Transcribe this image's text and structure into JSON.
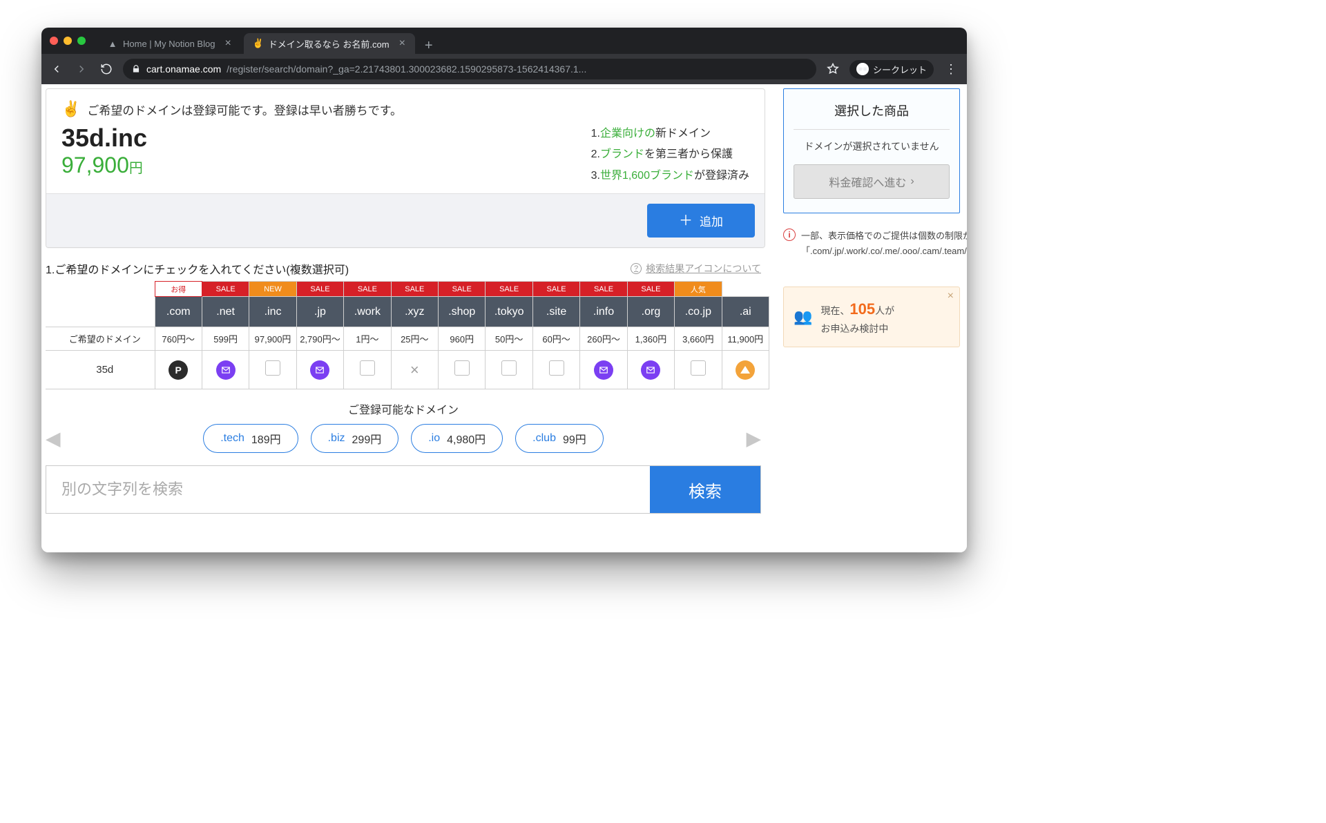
{
  "browser": {
    "tab1": "Home | My Notion Blog",
    "tab2": "ドメイン取るなら お名前.com",
    "host": "cart.onamae.com",
    "path": "/register/search/domain?_ga=2.21743801.300023682.1590295873-1562414367.1...",
    "incognito": "シークレット"
  },
  "card": {
    "msg": "ご希望のドメインは登録可能です。登録は早い者勝ちです。",
    "domain": "35d.inc",
    "price": "97,900",
    "currency": "円",
    "f1a": "1.",
    "f1b": "企業向けの",
    "f1c": "新ドメイン",
    "f2a": "2.",
    "f2b": "ブランド",
    "f2c": "を第三者から保護",
    "f3a": "3.",
    "f3b": "世界1,600ブランド",
    "f3c": "が登録済み",
    "add": "追加"
  },
  "section": {
    "title": "1.ご希望のドメインにチェックを入れてください(複数選択可)",
    "help": "検索結果アイコンについて"
  },
  "table": {
    "rowLabelHeader": "ご希望のドメイン",
    "rowDomain": "35d",
    "badges": [
      "お得",
      "SALE",
      "NEW",
      "SALE",
      "SALE",
      "SALE",
      "SALE",
      "SALE",
      "SALE",
      "SALE",
      "SALE",
      "人気"
    ],
    "tlds": [
      ".com",
      ".net",
      ".inc",
      ".jp",
      ".work",
      ".xyz",
      ".shop",
      ".tokyo",
      ".site",
      ".info",
      ".org",
      ".co.jp",
      ".ai"
    ],
    "prices": [
      "760円〜",
      "599円",
      "97,900円",
      "2,790円〜",
      "1円〜",
      "25円〜",
      "960円",
      "50円〜",
      "60円〜",
      "260円〜",
      "1,360円",
      "3,660円",
      "11,900円"
    ]
  },
  "sug": {
    "title": "ご登録可能なドメイン",
    "items": [
      {
        "tld": ".tech",
        "price": "189円"
      },
      {
        "tld": ".biz",
        "price": "299円"
      },
      {
        "tld": ".io",
        "price": "4,980円"
      },
      {
        "tld": ".club",
        "price": "99円"
      }
    ]
  },
  "search": {
    "placeholder": "別の文字列を検索",
    "button": "検索"
  },
  "sidebar": {
    "title": "選択した商品",
    "empty": "ドメインが選択されていません",
    "proceed": "料金確認へ進む",
    "note": "一部、表示価格でのご提供は個数の制限があります。「.com/.jp/.work/.co/.me/.ooo/.cam/.team/.ltd/.care/.city/.delivery/.news/.report/.rocks/.town/.xyz/.tokyo/.site/.info/.today」"
  },
  "popup": {
    "pre": "現在、",
    "num": "105",
    "suf1": "人が",
    "suf2": "お申込み検討中"
  }
}
